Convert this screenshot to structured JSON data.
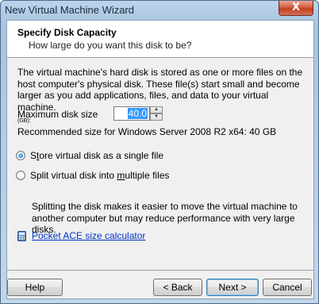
{
  "window": {
    "title": "New Virtual Machine Wizard",
    "close_glyph": "X"
  },
  "header": {
    "title": "Specify Disk Capacity",
    "subtitle": "How large do you want this disk to be?"
  },
  "description": "The virtual machine's hard disk is stored as one or more files on the host computer's physical disk. These file(s) start small and become larger as you add applications, files, and data to your virtual machine.",
  "disk_size": {
    "label": "Maximum disk size",
    "unit": "(GB):",
    "value": "40.0"
  },
  "recommended": "Recommended size for Windows Server 2008 R2 x64: 40 GB",
  "options": {
    "single_file": {
      "label_pre": "S",
      "label_accel": "t",
      "label_post": "ore virtual disk as a single file",
      "checked": true
    },
    "multiple_files": {
      "label_pre": "Split virtual disk into ",
      "label_accel": "m",
      "label_post": "ultiple files",
      "checked": false
    }
  },
  "split_note": "Splitting the disk makes it easier to move the virtual machine to another computer but may reduce performance with very large disks.",
  "calculator_link": "Pocket ACE size calculator",
  "buttons": {
    "help": "Help",
    "back": "< Back",
    "next": "Next >",
    "cancel": "Cancel"
  },
  "icons": {
    "calculator": "calculator-icon",
    "spin_up": "up-arrow-icon",
    "spin_down": "down-arrow-icon"
  },
  "colors": {
    "link": "#0033cc",
    "selection": "#3399ff",
    "close_button": "#c2401f"
  }
}
